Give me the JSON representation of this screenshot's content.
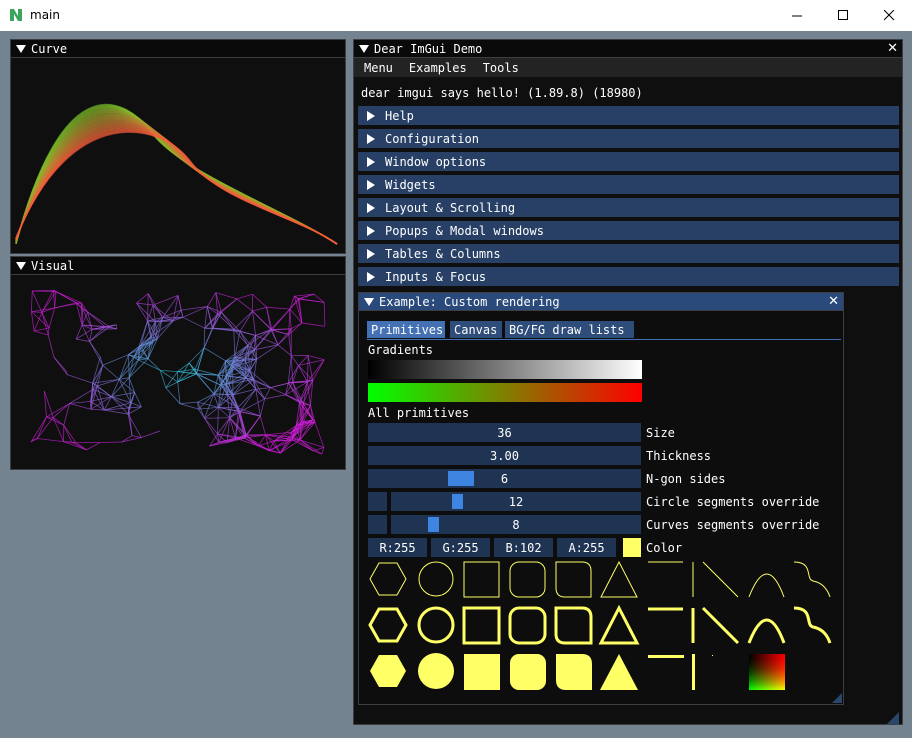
{
  "os_window": {
    "title": "main"
  },
  "curve_window": {
    "title": "Curve"
  },
  "visual_window": {
    "title": "Visual"
  },
  "demo_window": {
    "title": "Dear ImGui Demo",
    "menu": [
      "Menu",
      "Examples",
      "Tools"
    ],
    "hello": "dear imgui says hello! (1.89.8) (18980)",
    "headers": [
      "Help",
      "Configuration",
      "Window options",
      "Widgets",
      "Layout & Scrolling",
      "Popups & Modal windows",
      "Tables & Columns",
      "Inputs & Focus"
    ]
  },
  "custom_window": {
    "title": "Example: Custom rendering",
    "tabs": [
      "Primitives",
      "Canvas",
      "BG/FG draw lists"
    ],
    "gradients_label": "Gradients",
    "all_primitives_label": "All primitives",
    "size": {
      "value": "36",
      "label": "Size"
    },
    "thickness": {
      "value": "3.00",
      "label": "Thickness"
    },
    "ngon": {
      "value": "6",
      "label": "N-gon sides",
      "fraction": 0.32
    },
    "circle_seg": {
      "value": "12",
      "label": "Circle segments override",
      "fraction": 0.25
    },
    "curve_seg": {
      "value": "8",
      "label": "Curves segments override",
      "fraction": 0.15
    },
    "color": {
      "r": "R:255",
      "g": "G:255",
      "b": "B:102",
      "a": "A:255",
      "label": "Color",
      "swatch": "#ffff66"
    }
  },
  "colors": {
    "accent": "#4471b4",
    "header": "#284066",
    "prim": "#ffff66"
  }
}
